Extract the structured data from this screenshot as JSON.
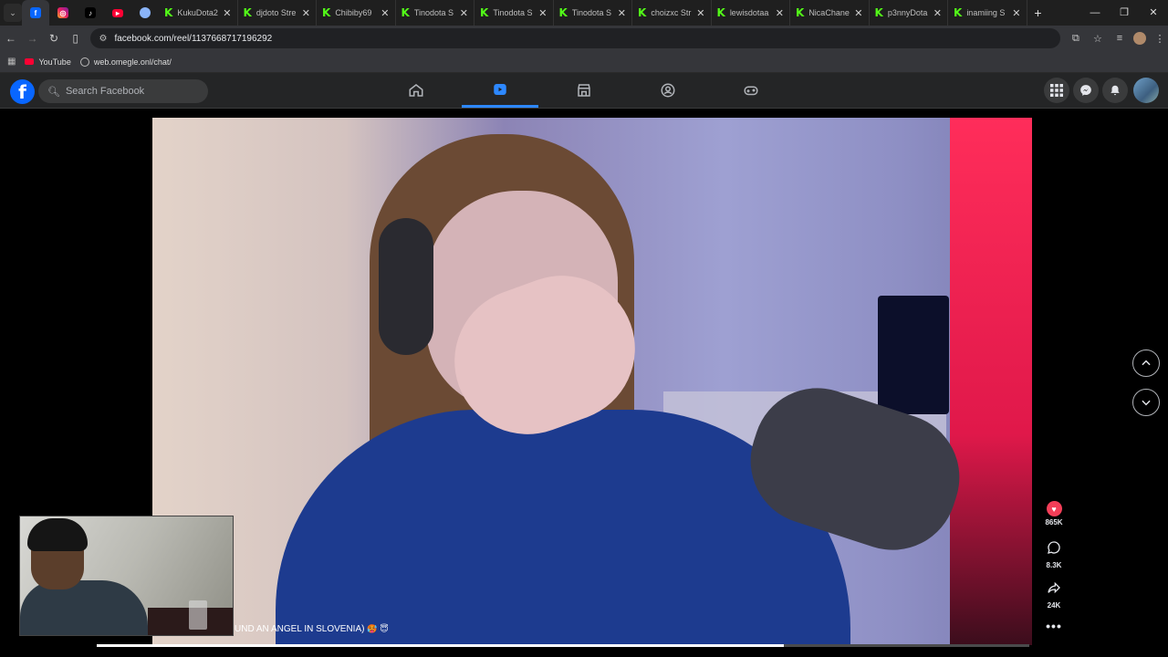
{
  "browser": {
    "tabs": [
      {
        "label": "KukuDota2",
        "icon": "kick-icon"
      },
      {
        "label": "djdoto Stre",
        "icon": "kick-icon"
      },
      {
        "label": "Chibiby69",
        "icon": "kick-icon"
      },
      {
        "label": "Tinodota S",
        "icon": "kick-icon"
      },
      {
        "label": "Tinodota S",
        "icon": "kick-icon"
      },
      {
        "label": "Tinodota S",
        "icon": "kick-icon"
      },
      {
        "label": "choizxc Str",
        "icon": "kick-icon"
      },
      {
        "label": "lewisdotaa",
        "icon": "kick-icon"
      },
      {
        "label": "NicaChane",
        "icon": "kick-icon"
      },
      {
        "label": "p3nnyDota",
        "icon": "kick-icon"
      },
      {
        "label": "inamiing S",
        "icon": "kick-icon"
      }
    ],
    "kick_glyph": "K",
    "close_glyph": "✕",
    "new_tab_glyph": "+",
    "url": "facebook.com/reel/1137668717196292",
    "bookmarks": [
      {
        "label": "YouTube",
        "icon": "youtube-icon"
      },
      {
        "label": "web.omegle.onl/chat/",
        "icon": "globe-icon"
      }
    ]
  },
  "facebook": {
    "logo": "f",
    "search_placeholder": "Search Facebook",
    "active_nav": "reels",
    "accent": "#2d88ff"
  },
  "reel": {
    "caption": "UND AN ANGEL IN SLOVENIA)",
    "caption_emoji": "🥵 😇",
    "likes": "865K",
    "comments": "8.3K",
    "shares": "24K",
    "more": "•••",
    "progress": 0.737
  }
}
